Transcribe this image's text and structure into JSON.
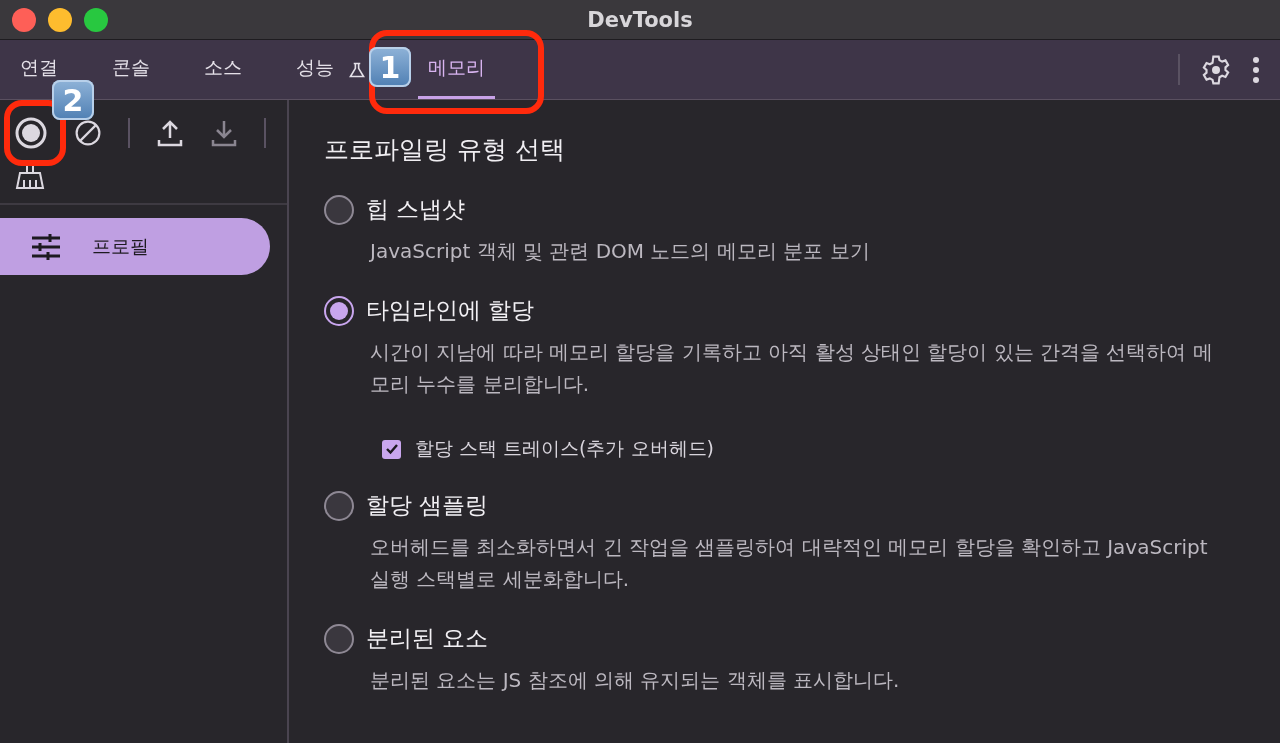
{
  "window": {
    "title": "DevTools"
  },
  "tabs": [
    {
      "label": "연결",
      "selected": false
    },
    {
      "label": "콘솔",
      "selected": false
    },
    {
      "label": "소스",
      "selected": false
    },
    {
      "label": "성능",
      "selected": false,
      "kind": "flask"
    },
    {
      "label": "메모리",
      "selected": true
    }
  ],
  "sidebar": {
    "items": [
      {
        "label": "프로필",
        "selected": true
      }
    ]
  },
  "panel": {
    "title": "프로파일링 유형 선택",
    "options": [
      {
        "label": "힙 스냅샷",
        "selected": false,
        "description": "JavaScript 객체 및 관련 DOM 노드의 메모리 분포 보기"
      },
      {
        "label": "타임라인에 할당",
        "selected": true,
        "description": "시간이 지남에 따라 메모리 할당을 기록하고 아직 활성 상태인 할당이 있는 간격을 선택하여 메모리 누수를 분리합니다.",
        "checkbox": {
          "label": "할당 스택 트레이스(추가 오버헤드)",
          "checked": true
        }
      },
      {
        "label": "할당 샘플링",
        "selected": false,
        "description": "오버헤드를 최소화하면서 긴 작업을 샘플링하여 대략적인 메모리 할당을 확인하고 JavaScript 실행 스택별로 세분화합니다."
      },
      {
        "label": "분리된 요소",
        "selected": false,
        "description": "분리된 요소는 JS 참조에 의해 유지되는 객체를 표시합니다."
      }
    ]
  },
  "annotations": [
    {
      "label": "1"
    },
    {
      "label": "2"
    }
  ]
}
